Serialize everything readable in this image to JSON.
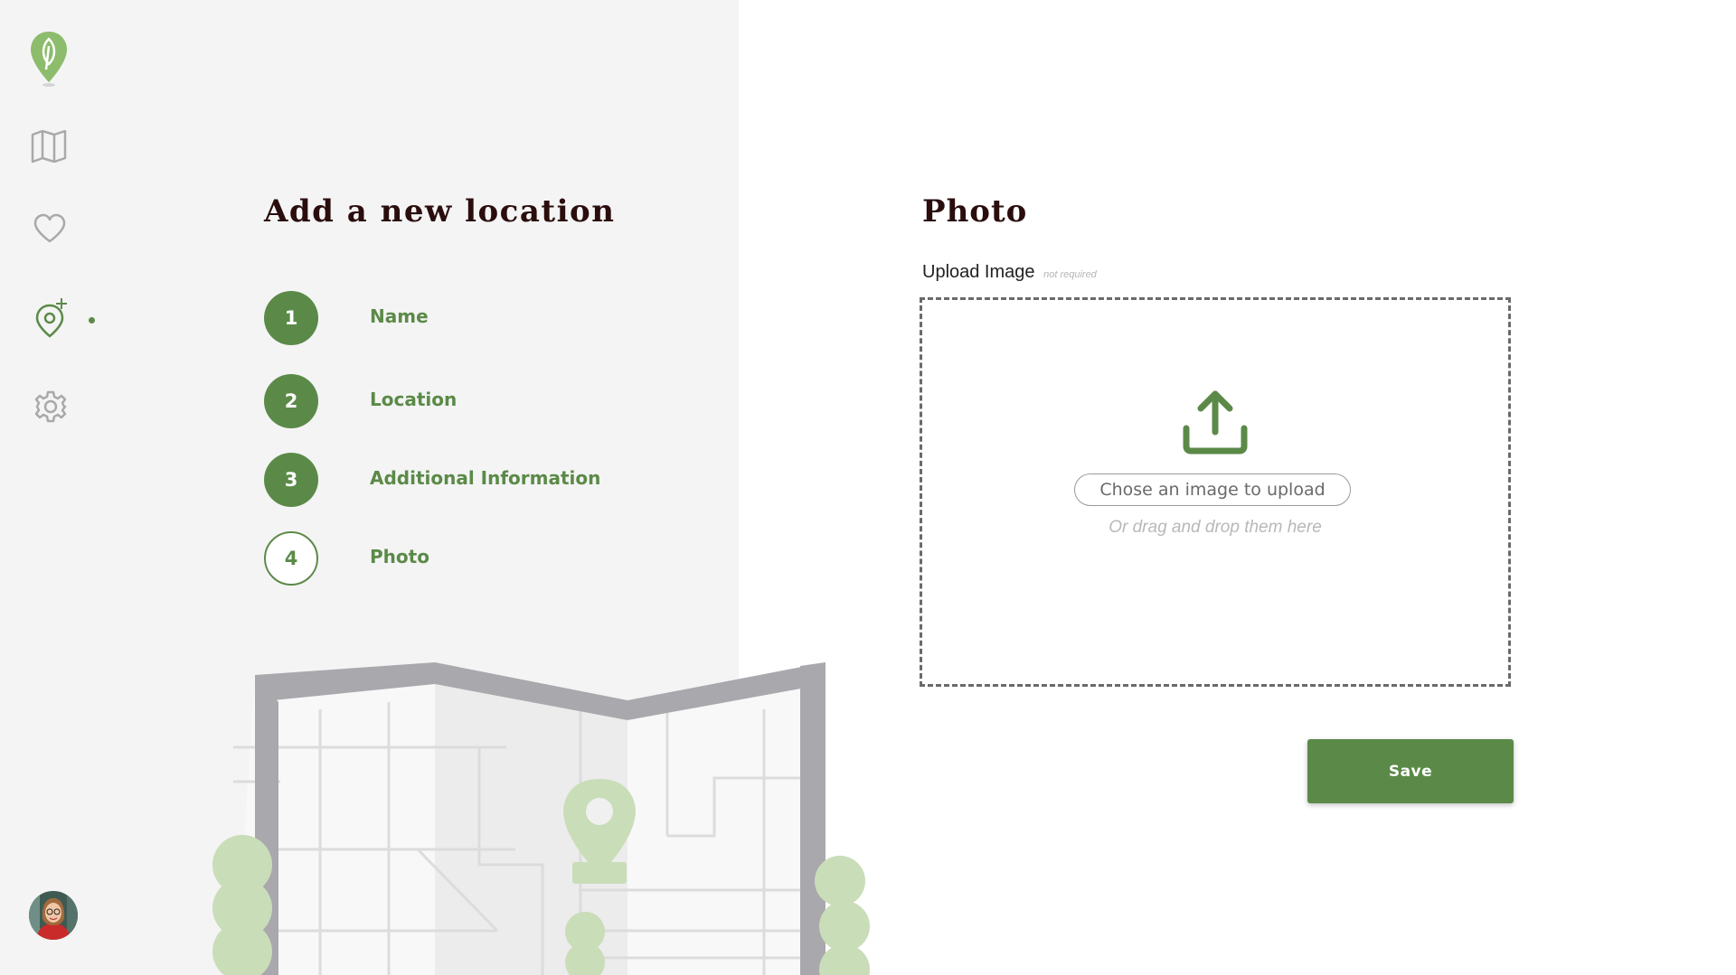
{
  "colors": {
    "accent": "#5b8a48",
    "heading": "#2b0d0d",
    "panel": "#f4f4f4"
  },
  "sidebar": {
    "items": [
      {
        "icon": "leaf-pin-logo-icon"
      },
      {
        "icon": "map-icon"
      },
      {
        "icon": "heart-icon"
      },
      {
        "icon": "add-location-icon",
        "active": true
      },
      {
        "icon": "gear-icon"
      }
    ],
    "avatar": "user-avatar"
  },
  "wizard": {
    "title": "Add a new location",
    "steps": [
      {
        "number": "1",
        "label": "Name",
        "state": "complete"
      },
      {
        "number": "2",
        "label": "Location",
        "state": "complete"
      },
      {
        "number": "3",
        "label": "Additional Information",
        "state": "complete"
      },
      {
        "number": "4",
        "label": "Photo",
        "state": "current"
      }
    ]
  },
  "photo": {
    "title": "Photo",
    "upload_label": "Upload Image",
    "upload_hint": "not required",
    "choose_button": "Chose an image to upload",
    "drag_text": "Or drag and drop them here",
    "upload_icon": "upload-icon"
  },
  "actions": {
    "save_label": "Save"
  }
}
